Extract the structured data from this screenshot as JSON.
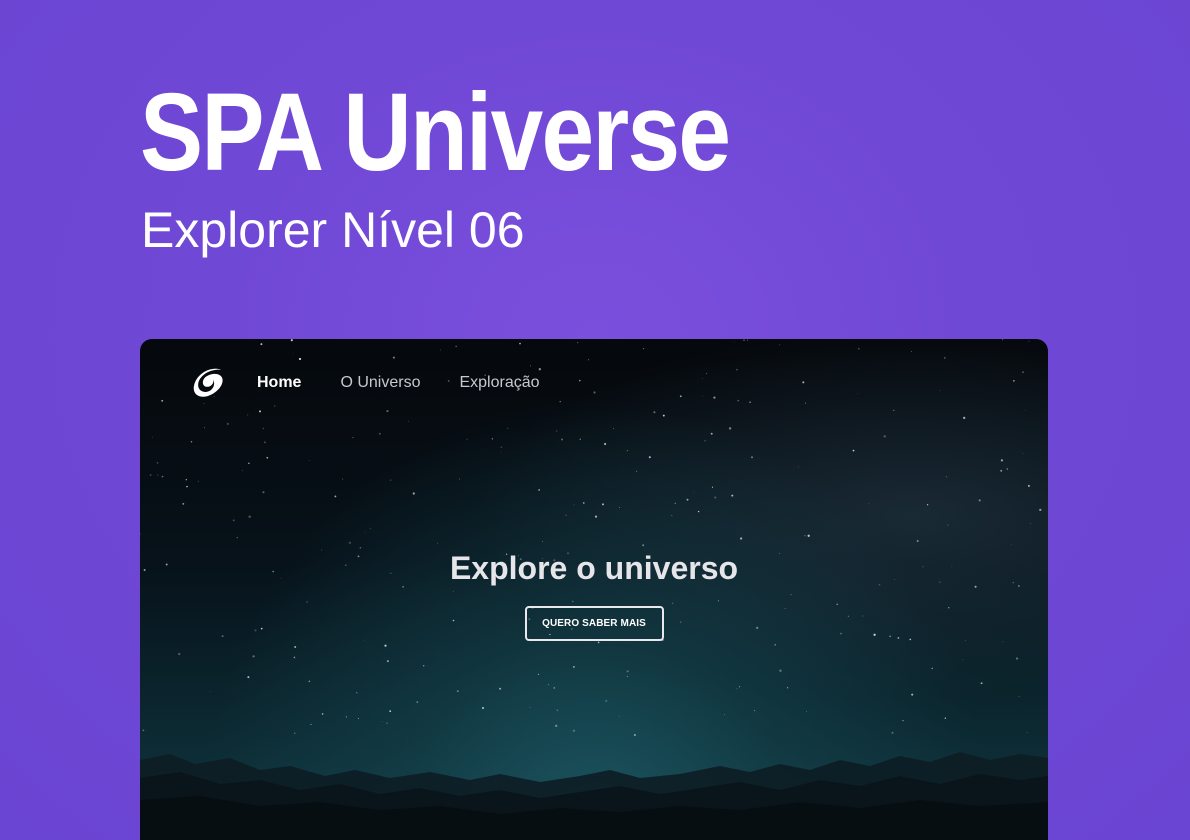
{
  "cover": {
    "title": "SPA Universe",
    "subtitle": "Explorer Nível 06",
    "background_color": "#7048d6"
  },
  "app": {
    "logo": "galaxy-swirl-icon",
    "nav": {
      "items": [
        {
          "label": "Home",
          "active": true
        },
        {
          "label": "O Universo",
          "active": false
        },
        {
          "label": "Exploração",
          "active": false
        }
      ]
    },
    "hero": {
      "title": "Explore o universo",
      "button_label": "QUERO SABER MAIS"
    },
    "colors": {
      "sky_top": "#05080c",
      "horizon_glow": "#1b5560",
      "text_primary": "#ffffff",
      "text_muted": "#c8c8d0"
    }
  }
}
